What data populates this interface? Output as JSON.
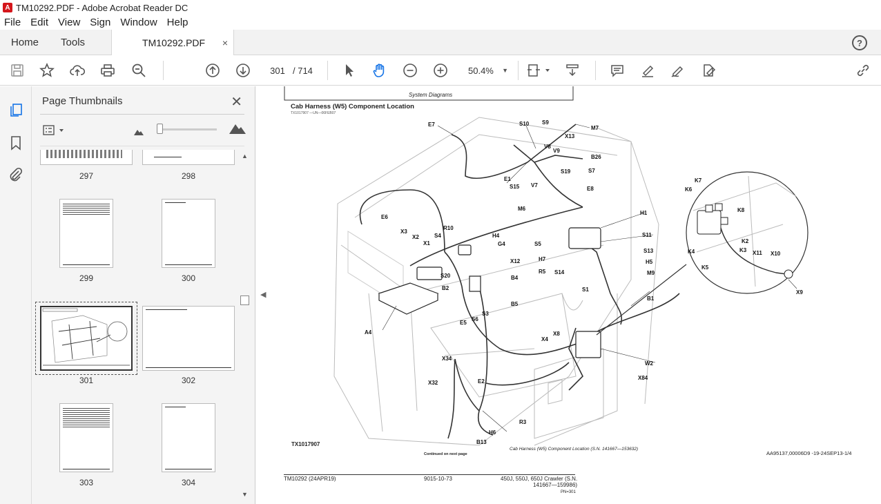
{
  "window": {
    "title": "TM10292.PDF - Adobe Acrobat Reader DC"
  },
  "menu": [
    "File",
    "Edit",
    "View",
    "Sign",
    "Window",
    "Help"
  ],
  "tabs": {
    "home": "Home",
    "tools": "Tools",
    "document": "TM10292.PDF",
    "close": "×"
  },
  "toolbar": {
    "current_page": "301",
    "total_pages": "/ 714",
    "zoom": "50.4%"
  },
  "thumbnails": {
    "title": "Page Thumbnails",
    "pages": [
      "297",
      "298",
      "299",
      "300",
      "301",
      "302",
      "303",
      "304"
    ],
    "selected": "301"
  },
  "document": {
    "header_box": "System Diagrams",
    "title": "Cab Harness (W5) Component Location",
    "subtitle": "TX1017907 —UN—06FEB07",
    "figure_id": "TX1017907",
    "continued": "Continued on next page",
    "caption": "Cab Harness (W5) Component Location (S.N. 141667—153632)",
    "ref": "AA95137,00006D9 -19-24SEP13-1/4",
    "footer_left": "TM10292 (24APR19)",
    "footer_center": "9015-10-73",
    "footer_right_1": "450J, 550J, 650J Crawler (S.N.",
    "footer_right_2": "141667—159986)",
    "footer_right_3": "PN=301",
    "callouts": [
      "E7",
      "S10",
      "S9",
      "M7",
      "X13",
      "V8",
      "V9",
      "B26",
      "S7",
      "E1",
      "S15",
      "V7",
      "S19",
      "E8",
      "E6",
      "M6",
      "X3",
      "X2",
      "X1",
      "R10",
      "S4",
      "H4",
      "G4",
      "H1",
      "S5",
      "S11",
      "H7",
      "S13",
      "H5",
      "R5",
      "S14",
      "M9",
      "X12",
      "S20",
      "B2",
      "B4",
      "S1",
      "B1",
      "B5",
      "E5",
      "S6",
      "S3",
      "A4",
      "X4",
      "X8",
      "W2",
      "X84",
      "X34",
      "X32",
      "E2",
      "R3",
      "H6",
      "B13",
      "K6",
      "K7",
      "K8",
      "K2",
      "K3",
      "K4",
      "K5",
      "X11",
      "X10",
      "X9"
    ]
  }
}
